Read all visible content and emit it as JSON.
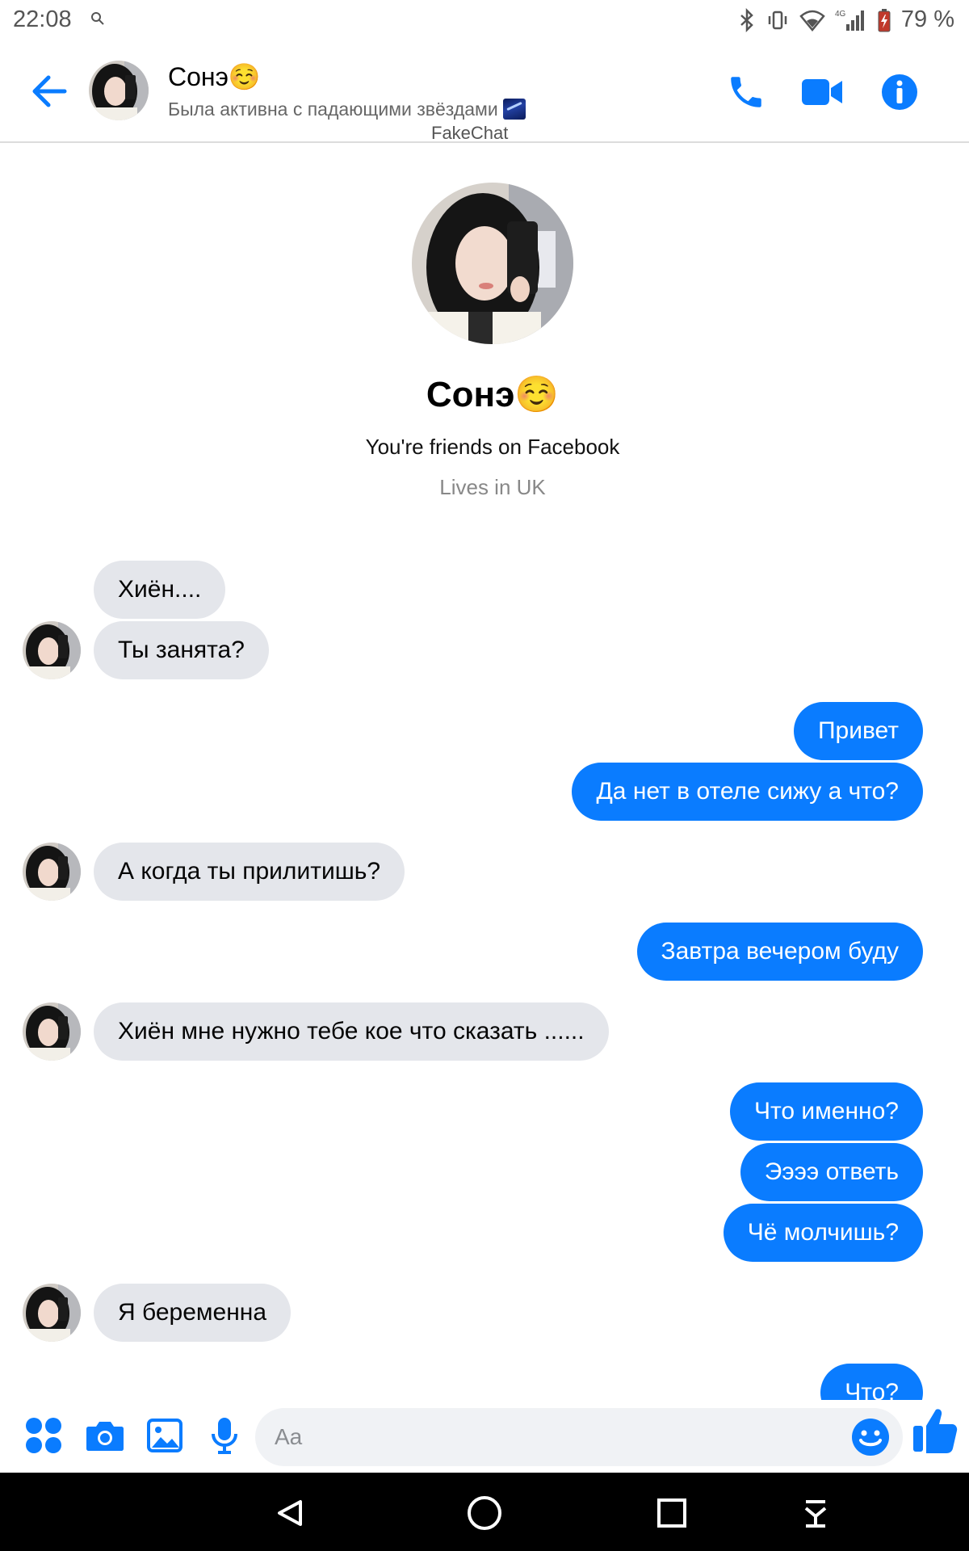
{
  "status_bar": {
    "time": "22:08",
    "battery": "79 %",
    "network": "4G"
  },
  "header": {
    "contact_name": "Сонэ☺️",
    "active_status": "Была активна с падающими звёздами",
    "watermark": "FakeChat"
  },
  "profile": {
    "name": "Сонэ☺️",
    "friends_line": "You're friends on Facebook",
    "location": "Lives in UK"
  },
  "messages": [
    {
      "side": "in",
      "text": "Хиён...."
    },
    {
      "side": "in",
      "text": "Ты занята?"
    },
    {
      "side": "out",
      "text": "Привет"
    },
    {
      "side": "out",
      "text": "Да нет в отеле сижу а что?"
    },
    {
      "side": "in",
      "text": "А когда ты прилитишь?"
    },
    {
      "side": "out",
      "text": "Завтра вечером буду"
    },
    {
      "side": "in",
      "text": "Хиён мне нужно тебе кое что сказать ......"
    },
    {
      "side": "out",
      "text": "Что именно?"
    },
    {
      "side": "out",
      "text": "Ээээ ответь"
    },
    {
      "side": "out",
      "text": "Чё молчишь?"
    },
    {
      "side": "in",
      "text": "Я беременна"
    },
    {
      "side": "out",
      "text": "Что?"
    }
  ],
  "composer": {
    "placeholder": "Aa"
  },
  "colors": {
    "accent": "#0a7cff",
    "incoming_bubble": "#e4e6eb",
    "nav_bar": "#000000"
  },
  "icons": [
    "arrow-left-icon",
    "phone-icon",
    "video-camera-icon",
    "info-icon",
    "apps-icon",
    "camera-icon",
    "image-icon",
    "microphone-icon",
    "smiley-icon",
    "thumbs-up-icon",
    "nav-back-icon",
    "nav-home-icon",
    "nav-recents-icon",
    "nav-notifications-icon"
  ]
}
